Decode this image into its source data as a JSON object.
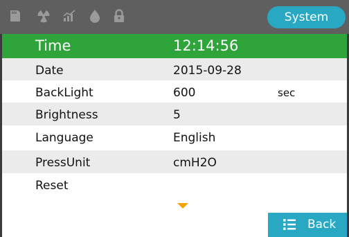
{
  "statusbar": {
    "icons": [
      "sd-card-icon",
      "radiation-icon",
      "signal-icon",
      "droplet-icon",
      "lock-icon"
    ],
    "system_label": "System"
  },
  "settings": [
    {
      "label": "Time",
      "value": "12:14:56",
      "unit": "",
      "selected": true
    },
    {
      "label": "Date",
      "value": "2015-09-28",
      "unit": ""
    },
    {
      "label": "BackLight",
      "value": "600",
      "unit": "sec"
    },
    {
      "label": "Brightness",
      "value": "5",
      "unit": ""
    },
    {
      "label": "Language",
      "value": "English",
      "unit": ""
    },
    {
      "label": "PressUnit",
      "value": "cmH2O",
      "unit": ""
    },
    {
      "label": "Reset",
      "value": "",
      "unit": ""
    }
  ],
  "footer": {
    "back_label": "Back"
  },
  "colors": {
    "statusbar": "#5f5f5f",
    "accent": "#29a8c3",
    "selected_row": "#2ea43a",
    "scroll_arrow": "#f2a400"
  }
}
